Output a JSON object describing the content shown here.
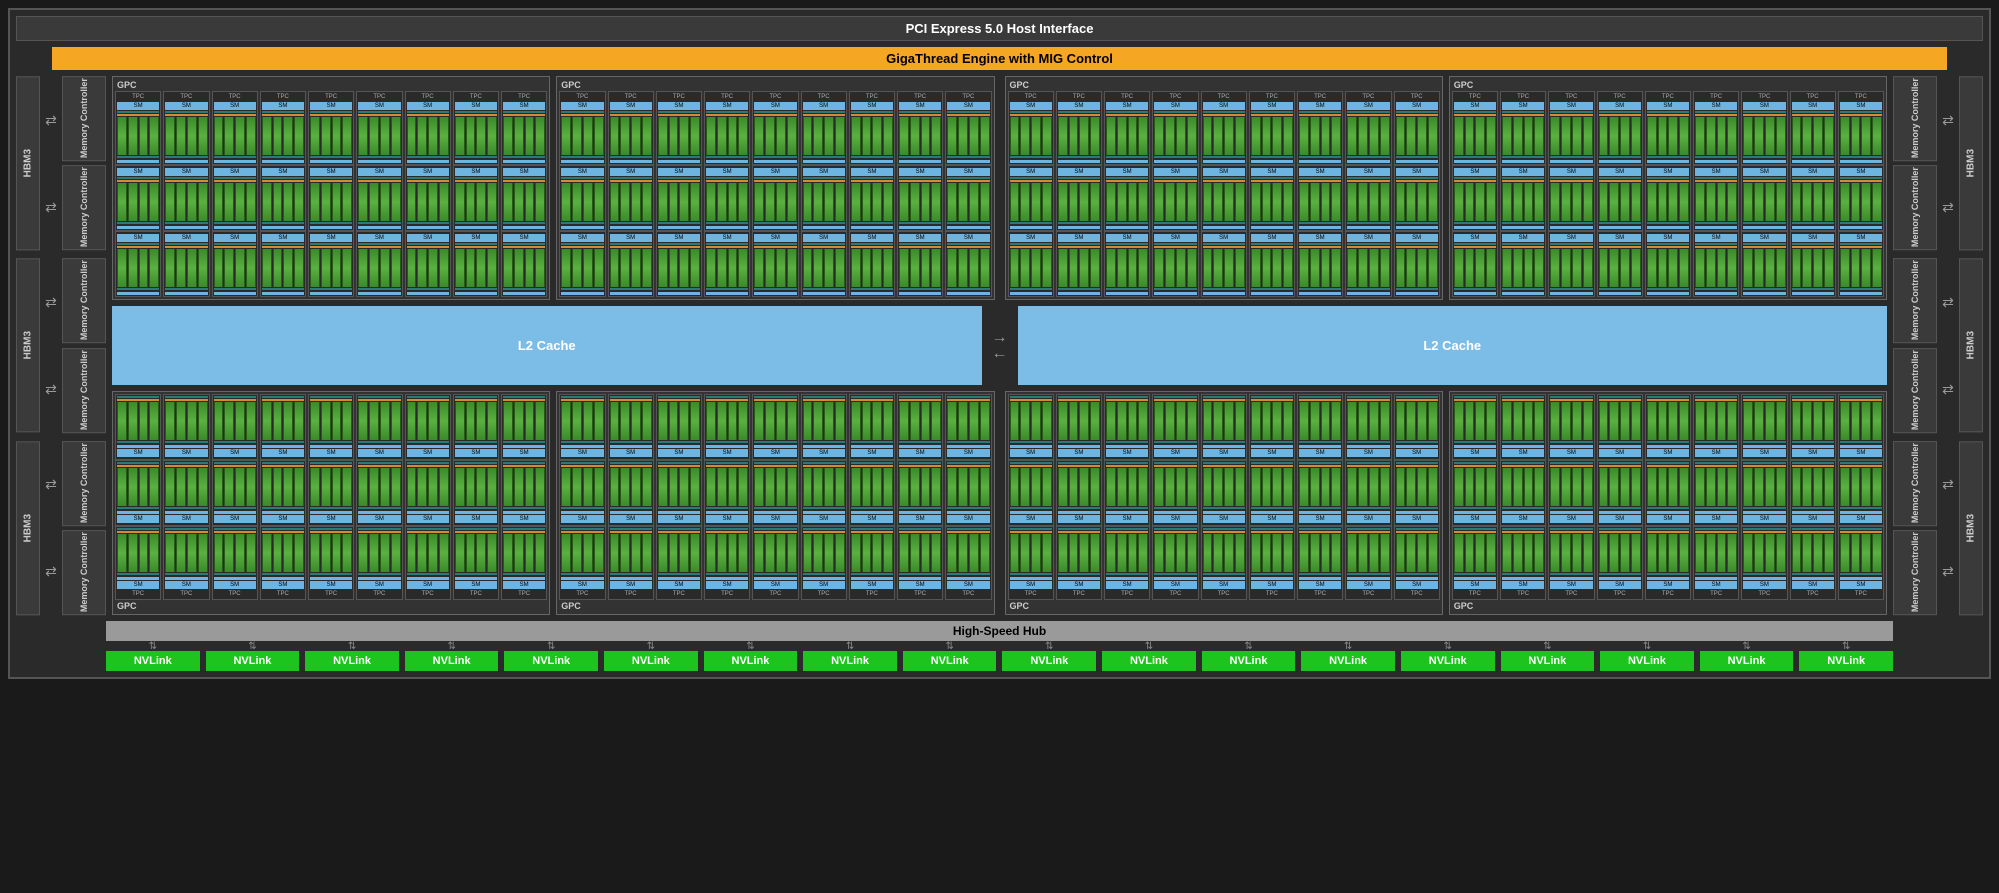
{
  "pci_label": "PCI Express 5.0 Host Interface",
  "giga_label": "GigaThread Engine with MIG Control",
  "gpc_label": "GPC",
  "tpc_label": "TPC",
  "sm_label": "SM",
  "l2_label": "L2 Cache",
  "hbm_label": "HBM3",
  "memc_label": "Memory Controller",
  "highspeed_label": "High-Speed Hub",
  "nvlink_label": "NVLink",
  "counts": {
    "gpc_rows": 2,
    "gpc_per_half": 2,
    "tpc_per_gpc": 9,
    "sm_rows_per_gpc": 3,
    "hbm_per_side": 3,
    "memc_per_hbm": 2,
    "nvlink_count": 18
  }
}
